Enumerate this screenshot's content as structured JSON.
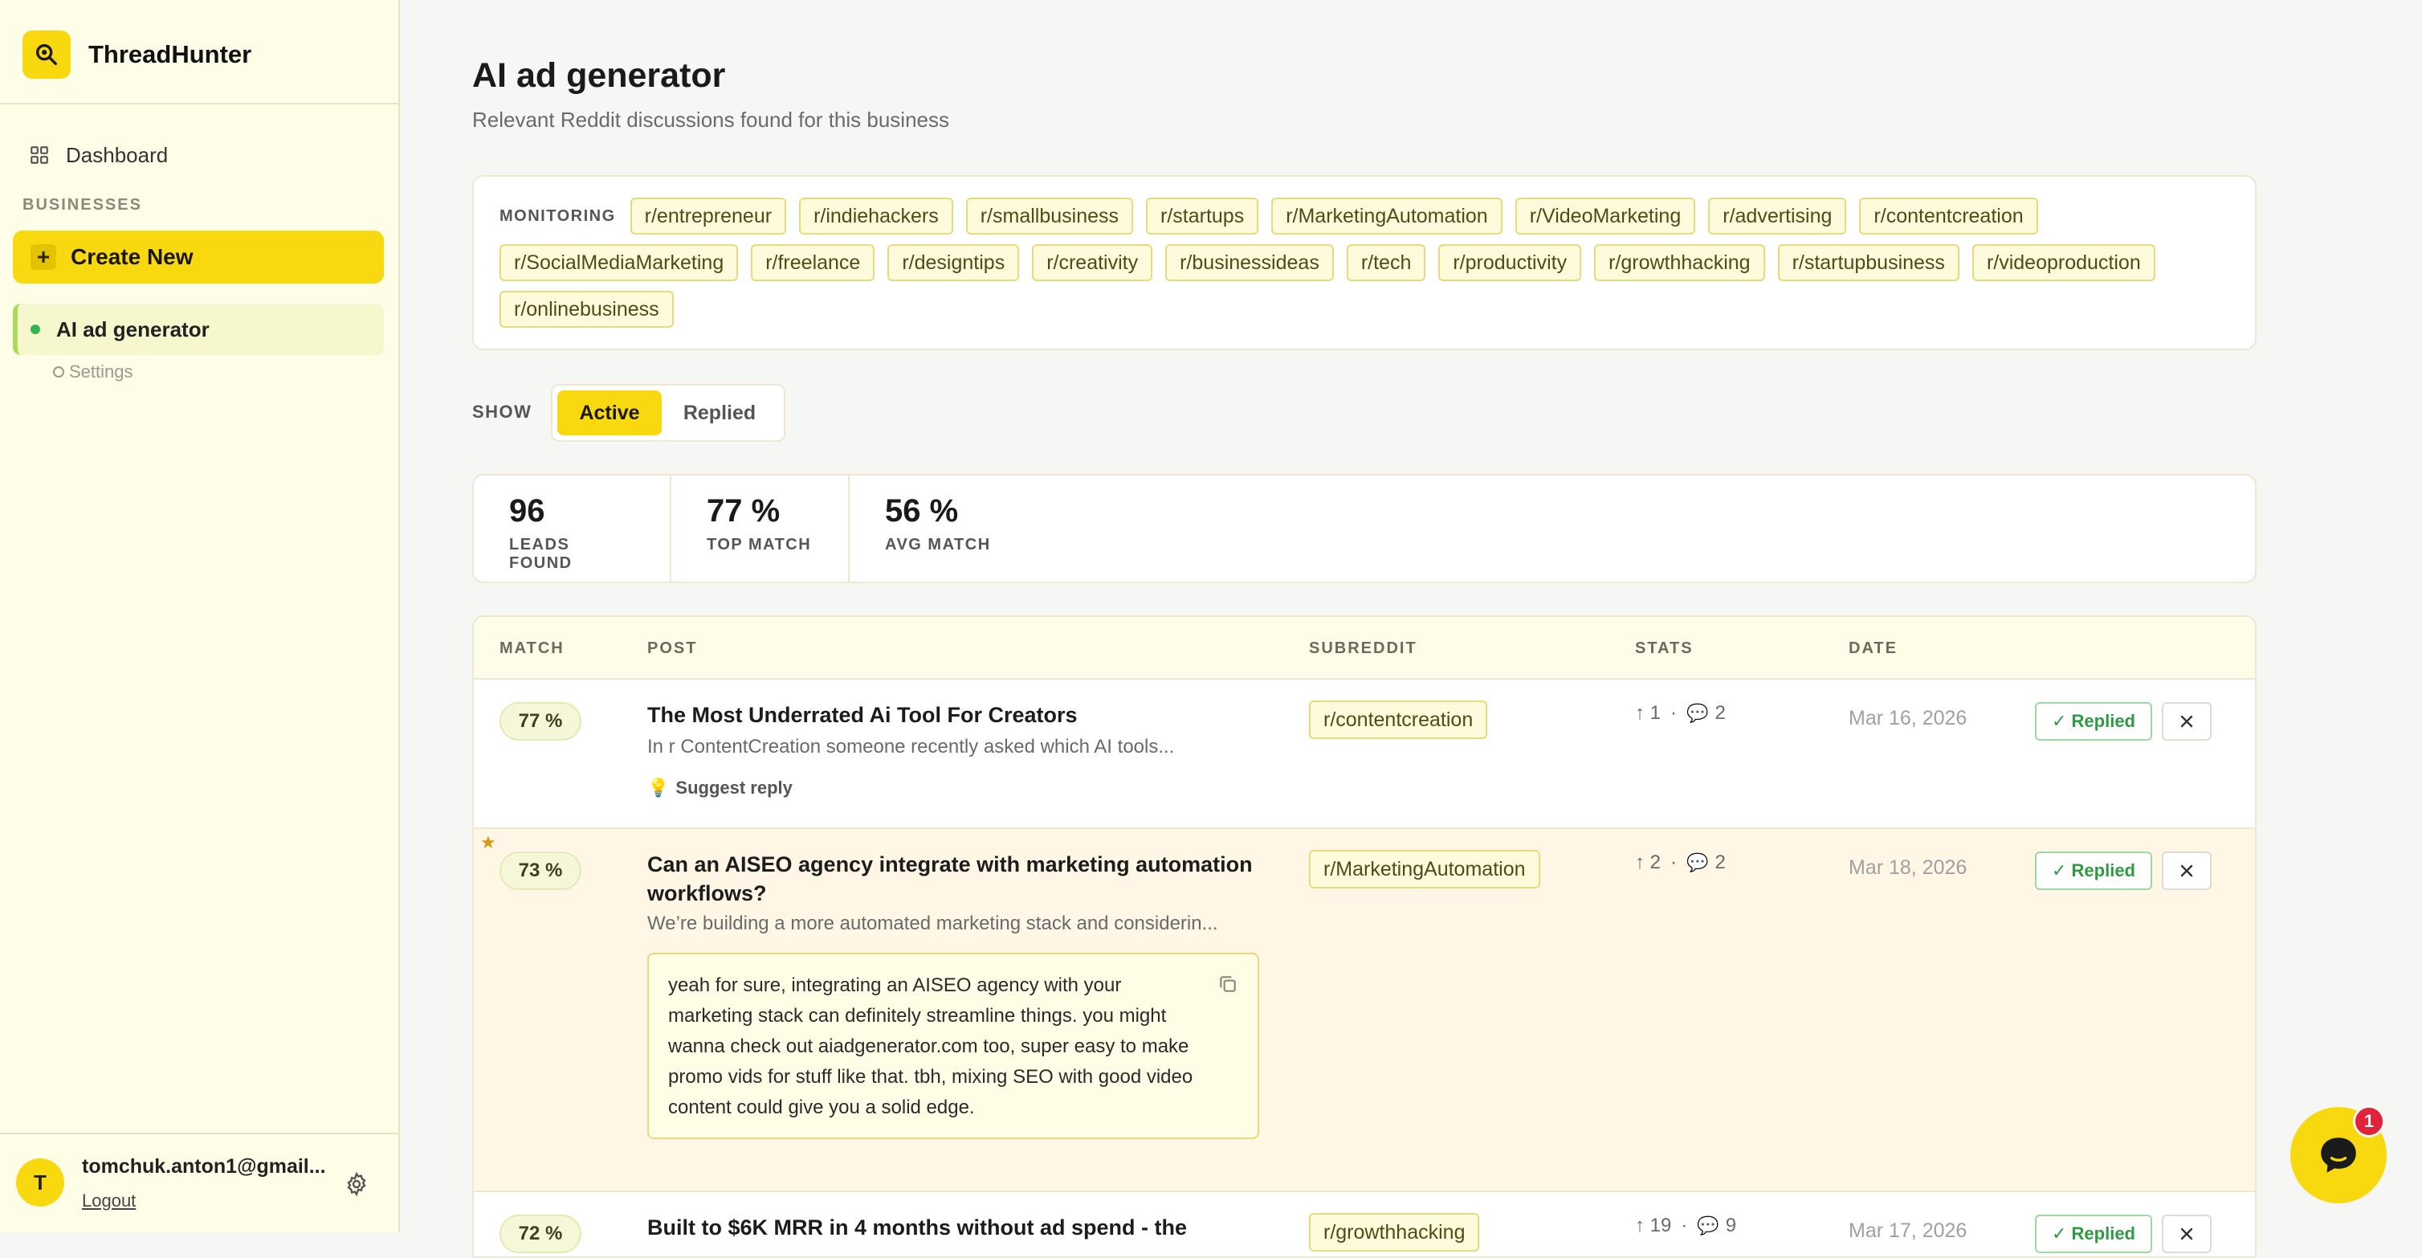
{
  "app": {
    "name": "ThreadHunter"
  },
  "sidebar": {
    "dashboard_label": "Dashboard",
    "section_label": "BUSINESSES",
    "create_label": "Create New",
    "business": {
      "name": "AI ad generator",
      "settings_label": "Settings"
    },
    "user": {
      "initial": "T",
      "email": "tomchuk.anton1@gmail...",
      "logout_label": "Logout"
    }
  },
  "page": {
    "title": "AI ad generator",
    "subtitle": "Relevant Reddit discussions found for this business"
  },
  "monitoring": {
    "label": "MONITORING",
    "subreddits": [
      "r/entrepreneur",
      "r/indiehackers",
      "r/smallbusiness",
      "r/startups",
      "r/MarketingAutomation",
      "r/VideoMarketing",
      "r/advertising",
      "r/contentcreation",
      "r/SocialMediaMarketing",
      "r/freelance",
      "r/designtips",
      "r/creativity",
      "r/businessideas",
      "r/tech",
      "r/productivity",
      "r/growthhacking",
      "r/startupbusiness",
      "r/videoproduction",
      "r/onlinebusiness"
    ]
  },
  "filter": {
    "label": "SHOW",
    "active_label": "Active",
    "replied_label": "Replied"
  },
  "stats": {
    "leads": {
      "value": "96",
      "label": "LEADS FOUND"
    },
    "top": {
      "value": "77 %",
      "label": "TOP MATCH"
    },
    "avg": {
      "value": "56 %",
      "label": "AVG MATCH"
    }
  },
  "table": {
    "headers": {
      "match": "MATCH",
      "post": "POST",
      "subreddit": "SUBREDDIT",
      "stats": "STATS",
      "date": "DATE"
    },
    "replied_label": "✓ Replied",
    "suggest_label": "Suggest reply",
    "rows": [
      {
        "match": "77 %",
        "title": "The Most Underrated Ai Tool For Creators",
        "excerpt": "In r ContentCreation someone recently asked which AI tools...",
        "subreddit": "r/contentcreation",
        "upvotes": "1",
        "comments": "2",
        "date": "Mar 16, 2026"
      },
      {
        "match": "73 %",
        "title": "Can an AISEO agency integrate with marketing automation workflows?",
        "excerpt": "We’re building a more automated marketing stack and considerin...",
        "subreddit": "r/MarketingAutomation",
        "upvotes": "2",
        "comments": "2",
        "date": "Mar 18, 2026",
        "reply": "yeah for sure, integrating an AISEO agency with your marketing stack can definitely streamline things. you might wanna check out aiadgenerator.com too, super easy to make promo vids for stuff like that. tbh, mixing SEO with good video content could give you a solid edge."
      },
      {
        "match": "72 %",
        "title": "Built to $6K MRR in 4 months without ad spend - the",
        "subreddit": "r/growthhacking",
        "upvotes": "19",
        "comments": "9",
        "date": "Mar 17, 2026"
      }
    ]
  },
  "chat": {
    "badge_count": "1"
  }
}
